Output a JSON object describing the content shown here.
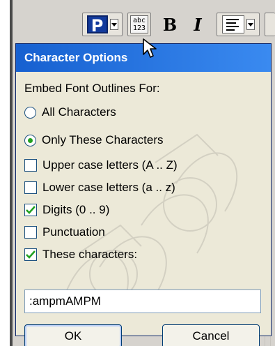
{
  "toolbar": {
    "paragraph_glyph": "P",
    "abc_line1": "abc",
    "abc_line2": "123",
    "bold": "B",
    "italic": "I"
  },
  "dialog": {
    "title": "Character Options",
    "section_label": "Embed Font Outlines For:",
    "radios": [
      {
        "label": "All Characters",
        "selected": false
      },
      {
        "label": "Only These Characters",
        "selected": true
      }
    ],
    "checkboxes": [
      {
        "label": "Upper case letters (A .. Z)",
        "checked": false
      },
      {
        "label": "Lower case letters (a .. z)",
        "checked": false
      },
      {
        "label": "Digits (0 .. 9)",
        "checked": true
      },
      {
        "label": "Punctuation",
        "checked": false
      },
      {
        "label": "These characters:",
        "checked": true
      }
    ],
    "characters_value": ":ampmAMPM",
    "ok_label": "OK",
    "cancel_label": "Cancel"
  },
  "colors": {
    "title_bar": "#1660d0",
    "dialog_bg": "#ece9d8",
    "check_mark": "#21a121",
    "toolbar_bg": "#d6d3ce"
  }
}
